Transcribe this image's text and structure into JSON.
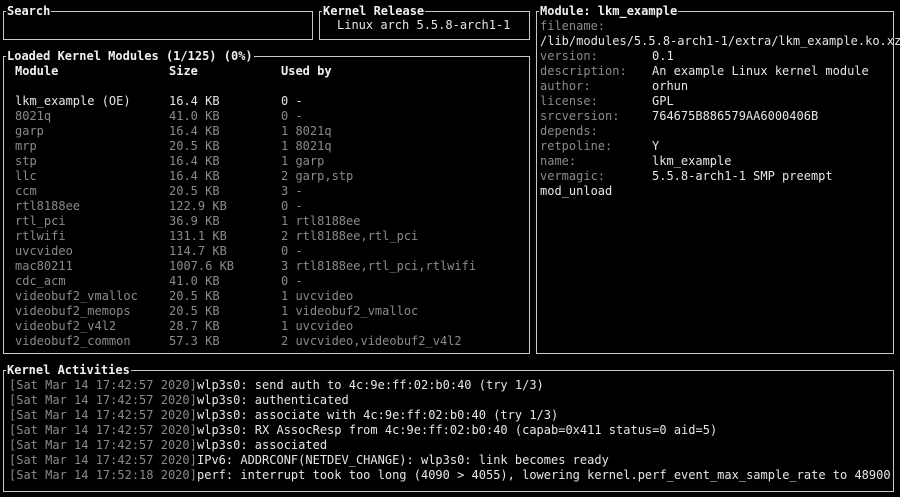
{
  "search": {
    "title": "Search",
    "value": ""
  },
  "kernel_release": {
    "title": "Kernel Release",
    "value": "Linux arch 5.5.8-arch1-1"
  },
  "modules": {
    "title": "Loaded Kernel Modules (1/125) (0%)",
    "headers": [
      "Module",
      "Size",
      "Used by"
    ],
    "rows": [
      {
        "name": "lkm_example (OE)",
        "size": "16.4 KB",
        "used": "0 -",
        "selected": true
      },
      {
        "name": "8021q",
        "size": "41.0 KB",
        "used": "0 -"
      },
      {
        "name": "garp",
        "size": "16.4 KB",
        "used": "1 8021q"
      },
      {
        "name": "mrp",
        "size": "20.5 KB",
        "used": "1 8021q"
      },
      {
        "name": "stp",
        "size": "16.4 KB",
        "used": "1 garp"
      },
      {
        "name": "llc",
        "size": "16.4 KB",
        "used": "2 garp,stp"
      },
      {
        "name": "ccm",
        "size": "20.5 KB",
        "used": "3 -"
      },
      {
        "name": "rtl8188ee",
        "size": "122.9 KB",
        "used": "0 -"
      },
      {
        "name": "rtl_pci",
        "size": "36.9 KB",
        "used": "1 rtl8188ee"
      },
      {
        "name": "rtlwifi",
        "size": "131.1 KB",
        "used": "2 rtl8188ee,rtl_pci"
      },
      {
        "name": "uvcvideo",
        "size": "114.7 KB",
        "used": "0 -"
      },
      {
        "name": "mac80211",
        "size": "1007.6 KB",
        "used": "3 rtl8188ee,rtl_pci,rtlwifi"
      },
      {
        "name": "cdc_acm",
        "size": "41.0 KB",
        "used": "0 -"
      },
      {
        "name": "videobuf2_vmalloc",
        "size": "20.5 KB",
        "used": "1 uvcvideo"
      },
      {
        "name": "videobuf2_memops",
        "size": "20.5 KB",
        "used": "1 videobuf2_vmalloc"
      },
      {
        "name": "videobuf2_v4l2",
        "size": "28.7 KB",
        "used": "1 uvcvideo"
      },
      {
        "name": "videobuf2_common",
        "size": "57.3 KB",
        "used": "2 uvcvideo,videobuf2_v4l2"
      }
    ]
  },
  "module_info": {
    "title": "Module: lkm_example",
    "filename_label": "filename:",
    "filename_value": "/lib/modules/5.5.8-arch1-1/extra/lkm_example.ko.xz",
    "fields": [
      {
        "key": "version:",
        "value": "0.1"
      },
      {
        "key": "description:",
        "value": "An example Linux kernel module"
      },
      {
        "key": "author:",
        "value": "orhun"
      },
      {
        "key": "license:",
        "value": "GPL"
      },
      {
        "key": "srcversion:",
        "value": "764675B886579AA6000406B"
      },
      {
        "key": "depends:",
        "value": ""
      },
      {
        "key": "retpoline:",
        "value": "Y"
      },
      {
        "key": "name:",
        "value": "lkm_example"
      },
      {
        "key": "vermagic:",
        "value": "5.5.8-arch1-1 SMP preempt"
      }
    ],
    "footer": "mod_unload"
  },
  "activities": {
    "title": "Kernel Activities",
    "lines": [
      {
        "ts": "[Sat Mar 14 17:42:57 2020]",
        "msg": "wlp3s0: send auth to 4c:9e:ff:02:b0:40 (try 1/3)"
      },
      {
        "ts": "[Sat Mar 14 17:42:57 2020]",
        "msg": "wlp3s0: authenticated"
      },
      {
        "ts": "[Sat Mar 14 17:42:57 2020]",
        "msg": "wlp3s0: associate with 4c:9e:ff:02:b0:40 (try 1/3)"
      },
      {
        "ts": "[Sat Mar 14 17:42:57 2020]",
        "msg": "wlp3s0: RX AssocResp from 4c:9e:ff:02:b0:40 (capab=0x411 status=0 aid=5)"
      },
      {
        "ts": "[Sat Mar 14 17:42:57 2020]",
        "msg": "wlp3s0: associated"
      },
      {
        "ts": "[Sat Mar 14 17:42:57 2020]",
        "msg": "IPv6: ADDRCONF(NETDEV_CHANGE): wlp3s0: link becomes ready"
      },
      {
        "ts": "[Sat Mar 14 17:52:18 2020]",
        "msg": "perf: interrupt took too long (4090 > 4055), lowering kernel.perf_event_max_sample_rate to 48900"
      }
    ]
  }
}
